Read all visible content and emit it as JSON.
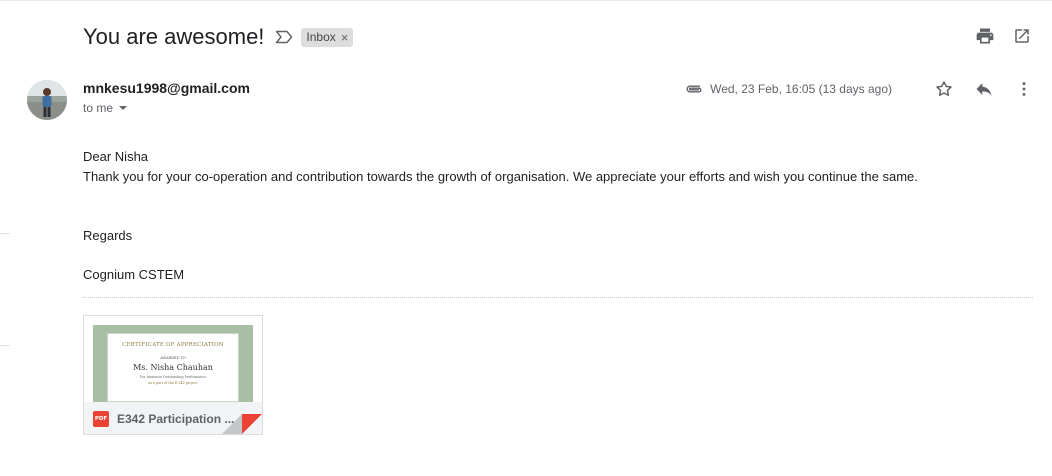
{
  "email": {
    "subject": "You are awesome!",
    "label": "Inbox",
    "label_remove": "×",
    "sender": "mnkesu1998@gmail.com",
    "recipient_label": "to me",
    "date": "Wed, 23 Feb, 16:05 (13 days ago)",
    "body": {
      "greeting": "Dear Nisha",
      "paragraph": "Thank you for your co-operation and contribution towards the growth of organisation. We appreciate your efforts and wish you continue the same.",
      "closing": "Regards",
      "signature": "Cognium CSTEM"
    }
  },
  "attachment": {
    "file_name": "E342 Participation ...",
    "type_badge": "PDF",
    "preview": {
      "title": "CERTIFICATE OF APPRECIATION",
      "presented_to": "AWARDED TO",
      "name": "Ms. Nisha Chauhan",
      "line1": "For Immense Outstanding Performance",
      "line2": "as a part of the E-342 project"
    }
  },
  "icons": {
    "importance": "importance-marker-icon",
    "print": "print-icon",
    "popout": "open-in-new-window-icon",
    "attachment": "paperclip-icon",
    "star": "star-icon",
    "reply": "reply-icon",
    "more": "more-vertical-icon"
  },
  "colors": {
    "text_primary": "#202124",
    "text_secondary": "#5f6368",
    "chip_bg": "#dddddd",
    "pdf_red": "#ea4335"
  }
}
